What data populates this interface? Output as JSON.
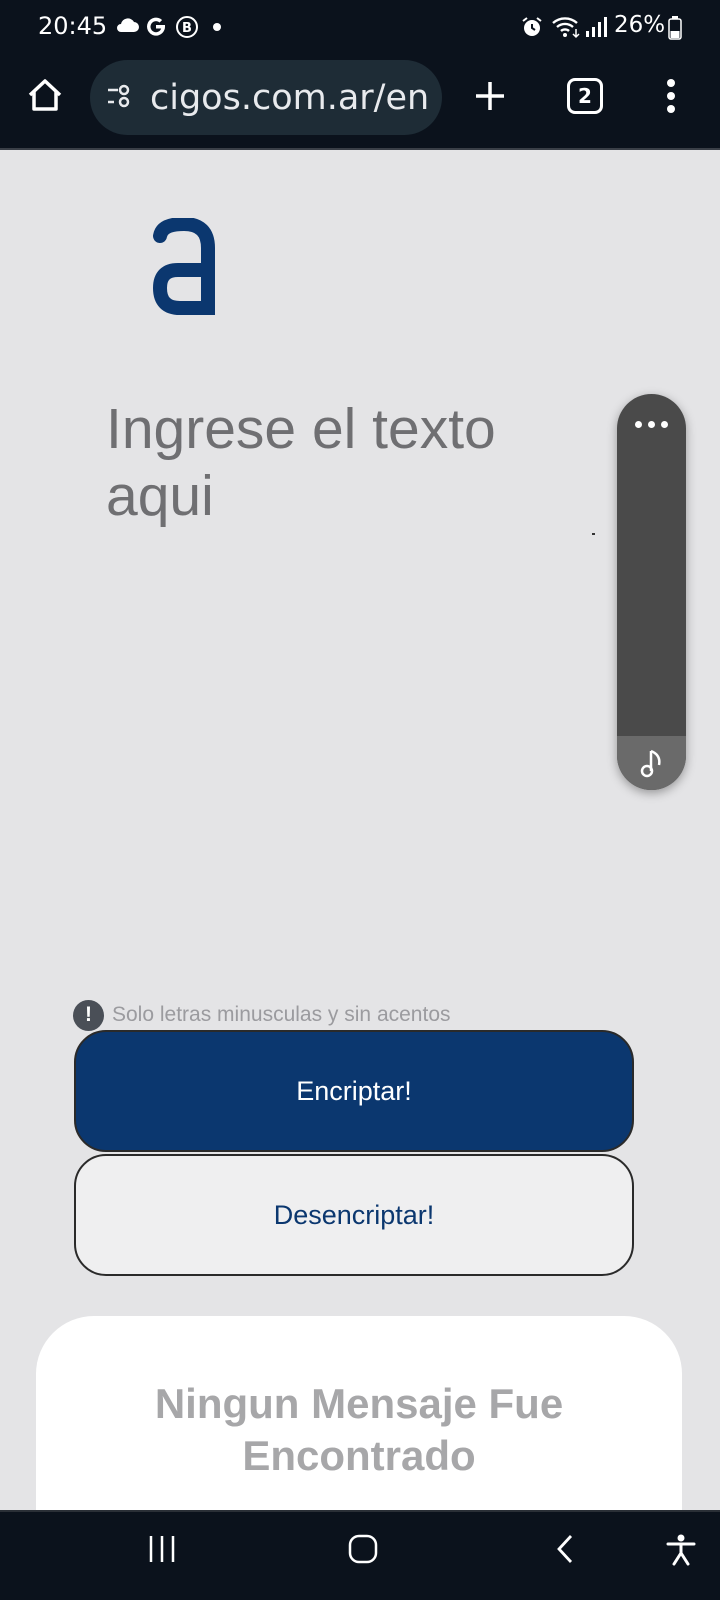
{
  "status_bar": {
    "time": "20:45",
    "notification_icons": [
      "cloud-icon",
      "google-icon",
      "b-badge-icon",
      "dot-icon"
    ],
    "system_icons": [
      "alarm-icon",
      "wifi-icon",
      "signal-icon",
      "battery-icon"
    ],
    "battery": "26%"
  },
  "browser": {
    "url": "cigos.com.ar/en",
    "tab_count": "2"
  },
  "page": {
    "textarea_placeholder": "Ingrese el texto aqui",
    "warning": "Solo letras minusculas y sin acentos",
    "warning_icon": "!",
    "encrypt_label": "Encriptar!",
    "decrypt_label": "Desencriptar!",
    "result_title": "Ningun Mensaje Fue Encontrado"
  },
  "colors": {
    "primary": "#0b376f",
    "background": "#e4e4e6",
    "system_bar": "#0b121c"
  }
}
